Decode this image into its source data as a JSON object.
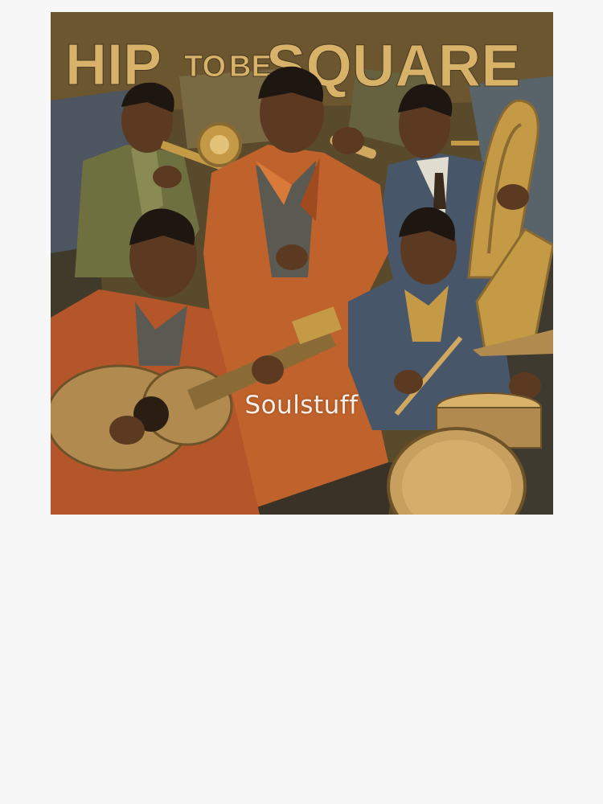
{
  "artwork": {
    "title_words": [
      "HIP",
      "TO",
      "BE",
      "SQUARE"
    ],
    "palette": {
      "background": "#5a4a2c",
      "title": "#d9b26a",
      "orange_suit": "#c0622b",
      "blue_suit": "#48566a",
      "olive_suit": "#6e7040",
      "skin": "#5c3a22",
      "hair": "#1e1610",
      "brass": "#c49a47",
      "wood": "#b08a4e",
      "page": "#f7f7f7"
    }
  },
  "watermark": {
    "text": "Soulstuff"
  }
}
